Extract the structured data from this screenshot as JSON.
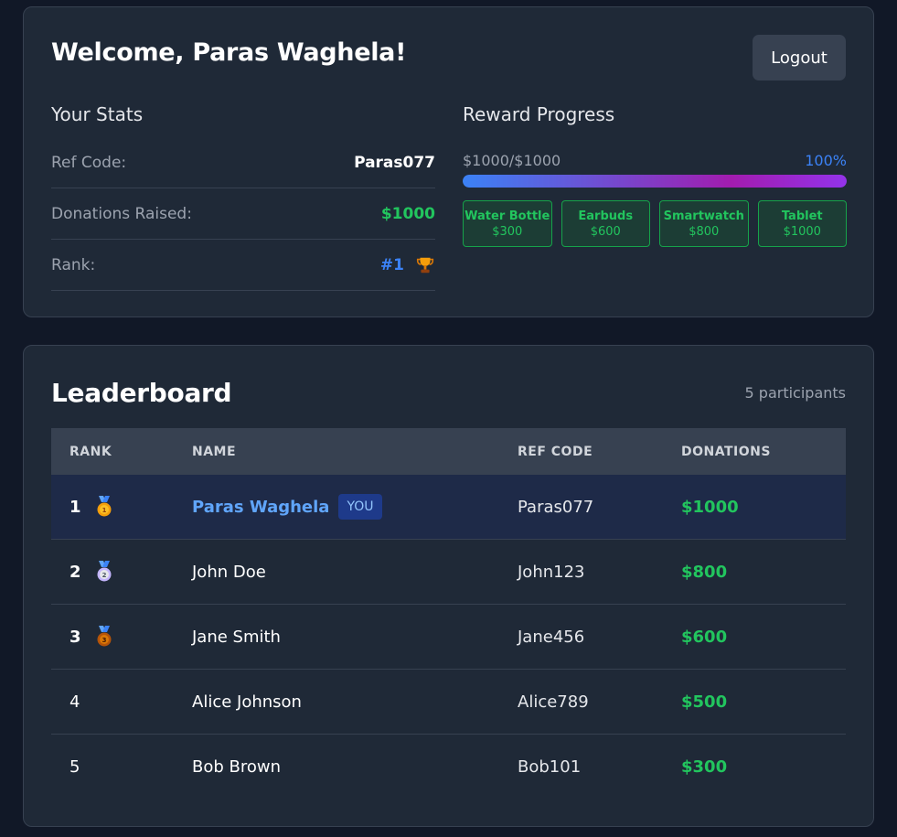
{
  "header": {
    "welcome": "Welcome, Paras Waghela!",
    "logout_label": "Logout"
  },
  "stats": {
    "title": "Your Stats",
    "ref_code_label": "Ref Code:",
    "ref_code_value": "Paras077",
    "donations_label": "Donations Raised:",
    "donations_value": "$1000",
    "rank_label": "Rank:",
    "rank_value": "#1",
    "rank_icon": "trophy-icon"
  },
  "reward": {
    "title": "Reward Progress",
    "amount": "$1000/$1000",
    "percent": "100%",
    "progress_fraction": 1.0,
    "tiers": [
      {
        "name": "Water Bottle",
        "price": "$300"
      },
      {
        "name": "Earbuds",
        "price": "$600"
      },
      {
        "name": "Smartwatch",
        "price": "$800"
      },
      {
        "name": "Tablet",
        "price": "$1000"
      }
    ]
  },
  "leaderboard": {
    "title": "Leaderboard",
    "participants": "5 participants",
    "columns": {
      "rank": "RANK",
      "name": "NAME",
      "ref": "REF CODE",
      "donations": "DONATIONS"
    },
    "you_badge": "YOU",
    "rows": [
      {
        "rank": "1",
        "name": "Paras Waghela",
        "ref": "Paras077",
        "donations": "$1000",
        "medal": "gold-medal-icon"
      },
      {
        "rank": "2",
        "name": "John Doe",
        "ref": "John123",
        "donations": "$800",
        "medal": "silver-medal-icon"
      },
      {
        "rank": "3",
        "name": "Jane Smith",
        "ref": "Jane456",
        "donations": "$600",
        "medal": "bronze-medal-icon"
      },
      {
        "rank": "4",
        "name": "Alice Johnson",
        "ref": "Alice789",
        "donations": "$500"
      },
      {
        "rank": "5",
        "name": "Bob Brown",
        "ref": "Bob101",
        "donations": "$300"
      }
    ]
  },
  "colors": {
    "background": "#111827",
    "card": "#1f2937",
    "accent_blue": "#3b82f6",
    "accent_green": "#22c55e",
    "progress_end": "#9333ea"
  }
}
